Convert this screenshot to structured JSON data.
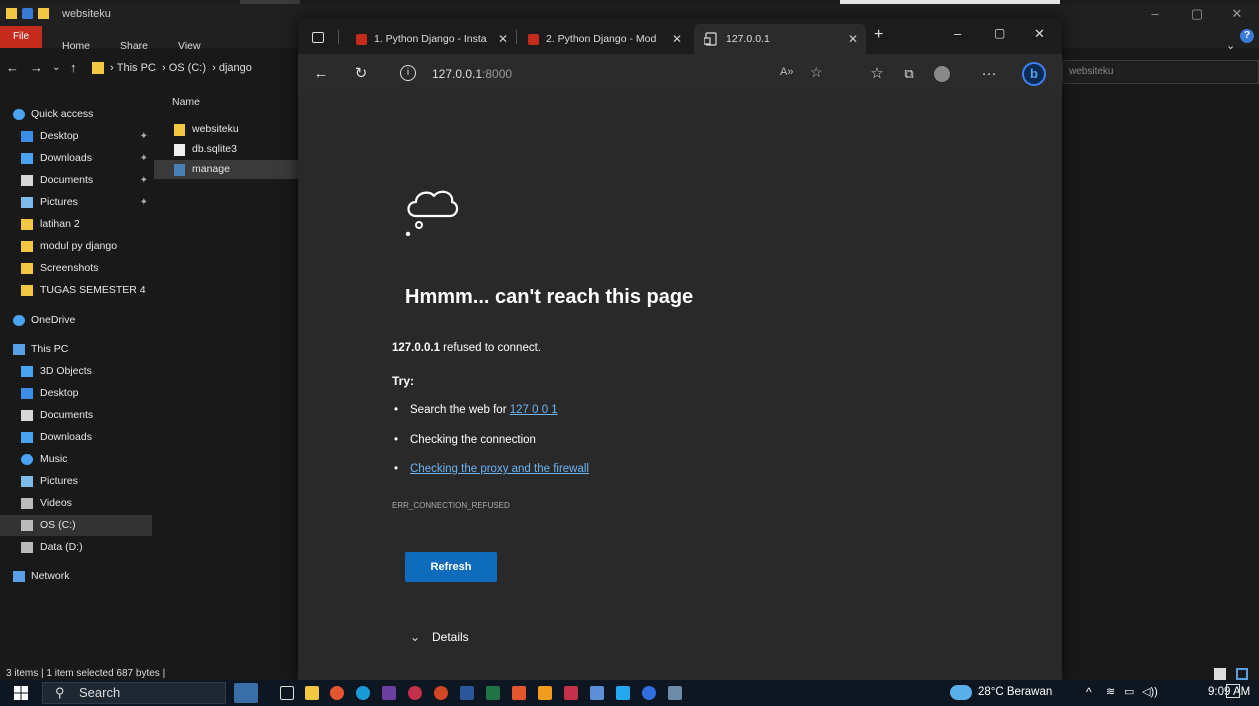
{
  "explorer": {
    "window_title": "websiteku",
    "ribbon_tabs": [
      "File",
      "Home",
      "Share",
      "View"
    ],
    "breadcrumb": [
      "This PC",
      "OS (C:)",
      "django"
    ],
    "search_placeholder": "websiteku",
    "column_header": "Name",
    "nav_items": [
      {
        "label": "Quick access",
        "icon": "star-icon",
        "level": 0,
        "pinned": false
      },
      {
        "label": "Desktop",
        "icon": "desktop-folder-icon",
        "level": 1,
        "pinned": true
      },
      {
        "label": "Downloads",
        "icon": "download-arrow-icon",
        "level": 1,
        "pinned": true
      },
      {
        "label": "Documents",
        "icon": "documents-icon",
        "level": 1,
        "pinned": true
      },
      {
        "label": "Pictures",
        "icon": "pictures-icon",
        "level": 1,
        "pinned": true
      },
      {
        "label": "latihan 2",
        "icon": "folder-icon",
        "level": 1,
        "pinned": false
      },
      {
        "label": "modul py django",
        "icon": "folder-icon",
        "level": 1,
        "pinned": false
      },
      {
        "label": "Screenshots",
        "icon": "folder-icon",
        "level": 1,
        "pinned": false
      },
      {
        "label": "TUGAS SEMESTER 4",
        "icon": "folder-icon",
        "level": 1,
        "pinned": false
      },
      {
        "label": "OneDrive",
        "icon": "cloud-icon",
        "level": 0,
        "pinned": false
      },
      {
        "label": "This PC",
        "icon": "computer-icon",
        "level": 0,
        "pinned": false
      },
      {
        "label": "3D Objects",
        "icon": "cube-icon",
        "level": 1,
        "pinned": false
      },
      {
        "label": "Desktop",
        "icon": "desktop-folder-icon",
        "level": 1,
        "pinned": false
      },
      {
        "label": "Documents",
        "icon": "documents-icon",
        "level": 1,
        "pinned": false
      },
      {
        "label": "Downloads",
        "icon": "download-arrow-icon",
        "level": 1,
        "pinned": false
      },
      {
        "label": "Music",
        "icon": "music-note-icon",
        "level": 1,
        "pinned": false
      },
      {
        "label": "Pictures",
        "icon": "pictures-icon",
        "level": 1,
        "pinned": false
      },
      {
        "label": "Videos",
        "icon": "video-icon",
        "level": 1,
        "pinned": false
      },
      {
        "label": "OS (C:)",
        "icon": "drive-icon",
        "level": 1,
        "pinned": false,
        "selected": true
      },
      {
        "label": "Data (D:)",
        "icon": "drive-icon",
        "level": 1,
        "pinned": false
      },
      {
        "label": "Network",
        "icon": "network-icon",
        "level": 0,
        "pinned": false
      }
    ],
    "files": [
      {
        "name": "websiteku",
        "icon": "folder-icon"
      },
      {
        "name": "db.sqlite3",
        "icon": "file-icon"
      },
      {
        "name": "manage",
        "icon": "python-file-icon",
        "selected": true
      }
    ],
    "status_bar": "3 items  |  1 item selected  687 bytes  |"
  },
  "browser": {
    "tabs": [
      {
        "label": "1. Python Django - Insta",
        "icon": "pdf-icon"
      },
      {
        "label": "2. Python Django - Mod",
        "icon": "pdf-icon"
      },
      {
        "label": "127.0.0.1",
        "icon": "page-icon",
        "active": true
      }
    ],
    "new_tab_label": "+",
    "url_host": "127.0.0.1",
    "url_port": ":8000",
    "error": {
      "title": "Hmmm... can't reach this page",
      "host": "127.0.0.1",
      "message": " refused to connect.",
      "try_label": "Try:",
      "search_prefix": "Search the web for ",
      "search_link": "127 0 0 1",
      "check_connection": "Checking the connection",
      "proxy_link": "Checking the proxy and the firewall",
      "code": "ERR_CONNECTION_REFUSED",
      "refresh_label": "Refresh",
      "details_label": "Details"
    }
  },
  "taskbar": {
    "search_label": "Search",
    "weather": "28°C  Berawan",
    "time": "9:09 AM"
  },
  "colors": {
    "accent_blue": "#0f6cbd",
    "link_blue": "#6cb4f2",
    "folder_yellow": "#f2c744",
    "file_tab_red": "#c42b1c"
  }
}
